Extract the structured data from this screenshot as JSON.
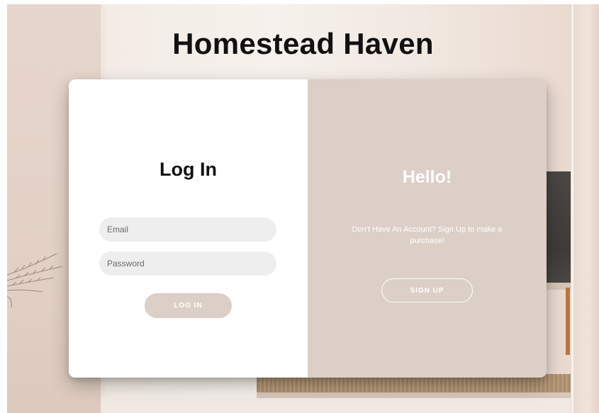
{
  "site": {
    "title": "Homestead Haven"
  },
  "login_panel": {
    "heading": "Log In",
    "email_placeholder": "Email",
    "password_placeholder": "Password",
    "submit_label": "LOG IN"
  },
  "signup_panel": {
    "heading": "Hello!",
    "message": "Don't Have An Account? Sign Up to make a purchase!",
    "button_label": "SIGN UP"
  },
  "colors": {
    "accent_beige": "#dccfc7",
    "input_gray": "#eeeeee",
    "title_text": "#111111"
  },
  "icons": {
    "background": "interior-room-photo"
  }
}
